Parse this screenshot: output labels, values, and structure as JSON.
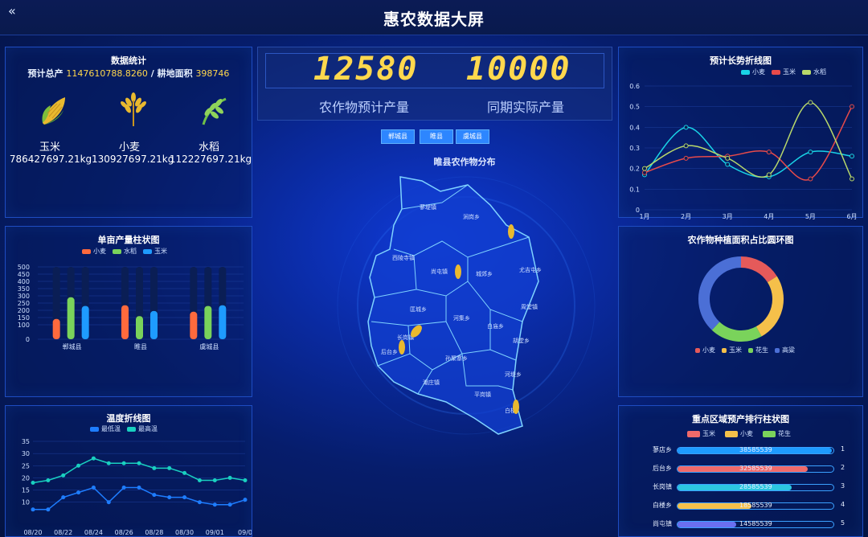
{
  "header": {
    "title": "惠农数据大屏",
    "back_icon": "«"
  },
  "stats": {
    "title": "数据统计",
    "summary_label": "预计总产",
    "summary_value": "1147610788.8260",
    "sep": "/",
    "area_label": "耕地面积",
    "area_value": "398746",
    "crops": [
      {
        "name": "玉米",
        "value": "786427697.21kg",
        "icon": "corn-icon"
      },
      {
        "name": "小麦",
        "value": "130927697.21kg",
        "icon": "wheat-icon"
      },
      {
        "name": "水稻",
        "value": "112227697.21kg",
        "icon": "rice-icon"
      }
    ]
  },
  "yield_chart": {
    "title": "单亩产量柱状图",
    "legend": [
      "小麦",
      "水稻",
      "玉米"
    ],
    "colors": [
      "#ff6a3d",
      "#7ad35b",
      "#1e9bff"
    ]
  },
  "temp_chart": {
    "title": "温度折线图",
    "legend": [
      "最低温",
      "最高温"
    ],
    "colors": [
      "#1e7dff",
      "#19d0c0"
    ]
  },
  "center": {
    "predicted_value": "12580",
    "predicted_label": "农作物预计产量",
    "actual_value": "10000",
    "actual_label": "同期实际产量",
    "buttons": [
      "郸城县",
      "睢县",
      "虞城县"
    ],
    "map_title": "睢县农作物分布",
    "towns": [
      "蓼堤镇",
      "涧岗乡",
      "西陵寺镇",
      "尚屯镇",
      "城郊乡",
      "尤吉屯乡",
      "匡城乡",
      "周堂镇",
      "河集乡",
      "白庙乡",
      "长岗镇",
      "胡堂乡",
      "后台乡",
      "孙聚寨乡",
      "河堤乡",
      "潮庄镇",
      "平岗镇",
      "白楼"
    ]
  },
  "trend_chart": {
    "title": "预计长势折线图",
    "legend": [
      "小麦",
      "玉米",
      "水稻"
    ],
    "colors": [
      "#19d3e6",
      "#e84a4a",
      "#b8d86a"
    ]
  },
  "ring_chart": {
    "title": "农作物种植面积占比圆环图",
    "legend": [
      "小麦",
      "玉米",
      "花生",
      "高粱"
    ],
    "colors": [
      "#e55a5a",
      "#f5c04a",
      "#7ad35b",
      "#4b6fd6"
    ]
  },
  "rank_chart": {
    "title": "重点区域预产排行柱状图",
    "legend": [
      "玉米",
      "小麦",
      "花生"
    ],
    "legend_colors": [
      "#f06a6a",
      "#f5c04a",
      "#7ad35b"
    ],
    "rows": [
      {
        "name": "蓼店乡",
        "value": "38585539",
        "rank": "1",
        "color": "#1e9bff"
      },
      {
        "name": "后台乡",
        "value": "32585539",
        "rank": "2",
        "color": "#f06a6a"
      },
      {
        "name": "长岗镇",
        "value": "28585539",
        "rank": "3",
        "color": "#2cc6e0"
      },
      {
        "name": "白楼乡",
        "value": "18585539",
        "rank": "4",
        "color": "#f5c04a"
      },
      {
        "name": "尚屯镇",
        "value": "14585539",
        "rank": "5",
        "color": "#6a6ff0"
      }
    ]
  },
  "chart_data": [
    {
      "type": "bar",
      "title": "单亩产量柱状图",
      "categories": [
        "郸城县",
        "睢县",
        "虞城县"
      ],
      "ylim": [
        0,
        500
      ],
      "yticks": [
        0,
        100,
        150,
        200,
        250,
        300,
        350,
        400,
        450,
        500
      ],
      "series": [
        {
          "name": "小麦",
          "values": [
            140,
            235,
            190
          ]
        },
        {
          "name": "水稻",
          "values": [
            290,
            160,
            230
          ]
        },
        {
          "name": "玉米",
          "values": [
            230,
            195,
            235
          ]
        }
      ]
    },
    {
      "type": "line",
      "title": "温度折线图",
      "categories": [
        "08/20",
        "08/21",
        "08/22",
        "08/23",
        "08/24",
        "08/25",
        "08/26",
        "08/27",
        "08/28",
        "08/29",
        "08/30",
        "08/31",
        "09/01",
        "09/02",
        "09/0"
      ],
      "xticks": [
        "08/20",
        "08/22",
        "08/24",
        "08/26",
        "08/28",
        "08/30",
        "09/01",
        "09/0"
      ],
      "ylim": [
        0,
        35
      ],
      "yticks": [
        10,
        15,
        20,
        25,
        30,
        35
      ],
      "series": [
        {
          "name": "最低温",
          "values": [
            7,
            7,
            12,
            14,
            16,
            10,
            16,
            16,
            13,
            12,
            12,
            10,
            9,
            9,
            11
          ]
        },
        {
          "name": "最高温",
          "values": [
            18,
            19,
            21,
            25,
            28,
            26,
            26,
            26,
            24,
            24,
            22,
            19,
            19,
            20,
            19
          ]
        }
      ]
    },
    {
      "type": "line",
      "title": "预计长势折线图",
      "categories": [
        "1月",
        "2月",
        "3月",
        "4月",
        "5月",
        "6月"
      ],
      "ylim": [
        0,
        0.6
      ],
      "yticks": [
        0,
        0.1,
        0.2,
        0.3,
        0.4,
        0.5,
        0.6
      ],
      "series": [
        {
          "name": "小麦",
          "values": [
            0.17,
            0.4,
            0.22,
            0.16,
            0.28,
            0.26
          ]
        },
        {
          "name": "玉米",
          "values": [
            0.18,
            0.25,
            0.26,
            0.28,
            0.15,
            0.5
          ]
        },
        {
          "name": "水稻",
          "values": [
            0.2,
            0.31,
            0.25,
            0.17,
            0.52,
            0.15
          ]
        }
      ]
    },
    {
      "type": "pie",
      "title": "农作物种植面积占比圆环图",
      "labels": [
        "小麦",
        "玉米",
        "花生",
        "高粱"
      ],
      "values": [
        16,
        26,
        20,
        38
      ]
    }
  ]
}
